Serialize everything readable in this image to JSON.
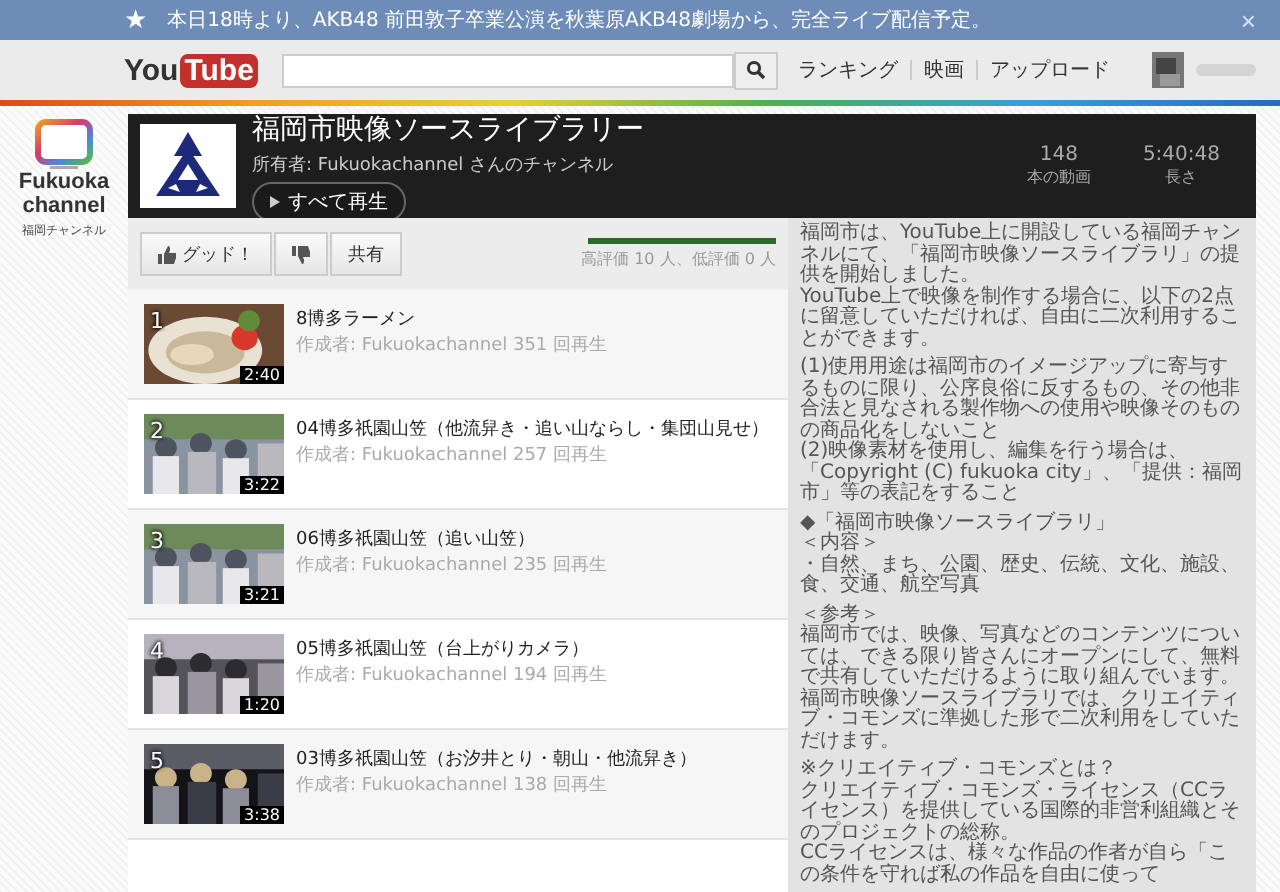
{
  "banner": {
    "icon": "★",
    "text": "本日18時より、AKB48 前田敦子卒業公演を秋葉原AKB48劇場から、完全ライブ配信予定。",
    "close": "×"
  },
  "header": {
    "logo": {
      "part1": "You",
      "part2": "Tube"
    },
    "nav": [
      "ランキング",
      "映画",
      "アップロード"
    ]
  },
  "channel_logo": {
    "line1": "Fukuoka",
    "line2": "channel",
    "caption": "福岡チャンネル"
  },
  "playlist": {
    "title": "福岡市映像ソースライブラリー",
    "owner": "所有者: Fukuokachannel さんのチャンネル",
    "play_all": "すべて再生",
    "stats": [
      {
        "value": "148",
        "label": "本の動画"
      },
      {
        "value": "5:40:48",
        "label": "長さ"
      }
    ]
  },
  "actions": {
    "like": "グッド！",
    "share": "共有",
    "level": 1,
    "rating_text": "高評価 10 人、低評価 0 人"
  },
  "videos": [
    {
      "index": "1",
      "duration": "2:40",
      "title": "8博多ラーメン",
      "meta": "作成者: Fukuokachannel 351 回再生"
    },
    {
      "index": "2",
      "duration": "3:22",
      "title": "04博多祇園山笠（他流舁き・追い山ならし・集団山見せ）",
      "meta": "作成者: Fukuokachannel 257 回再生"
    },
    {
      "index": "3",
      "duration": "3:21",
      "title": "06博多祇園山笠（追い山笠）",
      "meta": "作成者: Fukuokachannel 235 回再生"
    },
    {
      "index": "4",
      "duration": "1:20",
      "title": "05博多祇園山笠（台上がりカメラ）",
      "meta": "作成者: Fukuokachannel 194 回再生"
    },
    {
      "index": "5",
      "duration": "3:38",
      "title": "03博多祇園山笠（お汐井とり・朝山・他流舁き）",
      "meta": "作成者: Fukuokachannel 138 回再生"
    }
  ],
  "description": [
    [
      "福岡市は、YouTube上に開設している福岡チャンネルにて、「福岡市映像ソースライブラリ」の提供を開始しました。",
      "YouTube上で映像を制作する場合に、以下の2点に留意していただければ、自由に二次利用することができます。"
    ],
    [
      "(1)使用用途は福岡市のイメージアップに寄与するものに限り、公序良俗に反するもの、その他非合法と見なされる製作物への使用や映像そのものの商品化をしないこと",
      "(2)映像素材を使用し、編集を行う場合は、「Copyright (C) fukuoka city」、「提供：福岡市」等の表記をすること"
    ],
    [
      "◆「福岡市映像ソースライブラリ」",
      "＜内容＞",
      "・自然、まち、公園、歴史、伝統、文化、施設、食、交通、航空写真"
    ],
    [
      "＜参考＞",
      "福岡市では、映像、写真などのコンテンツについては、できる限り皆さんにオープンにして、無料で共有していただけるように取り組んでいます。福岡市映像ソースライブラリでは、クリエイティブ・コモンズに準拠した形で二次利用をしていただけます。"
    ],
    [
      "※クリエイティブ・コモンズとは？",
      "クリエイティブ・コモンズ・ライセンス（CCライセンス）を提供している国際的非営利組織とそのプロジェクトの総称。",
      "CCライセンスは、様々な作品の作者が自ら「この条件を守れば私の作品を自由に使って"
    ]
  ]
}
